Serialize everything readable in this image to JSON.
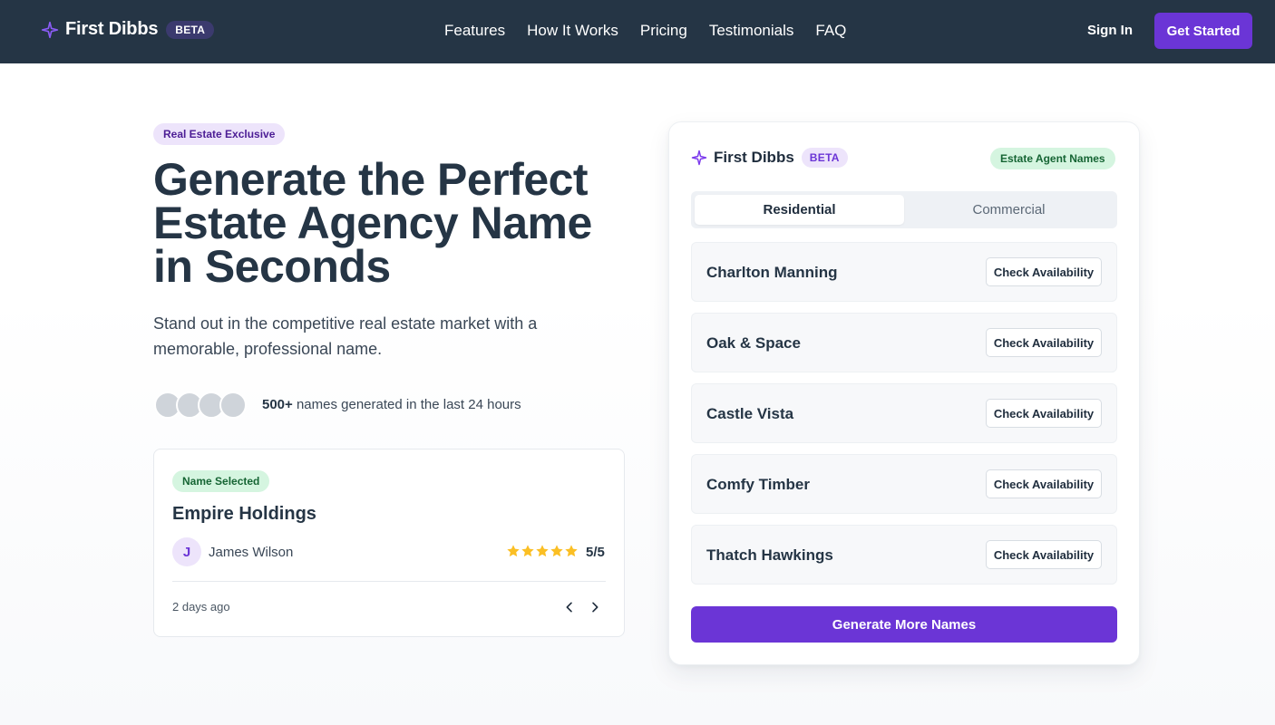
{
  "nav": {
    "brand": "First Dibbs",
    "beta": "BETA",
    "links": [
      "Features",
      "How It Works",
      "Pricing",
      "Testimonials",
      "FAQ"
    ],
    "sign_in": "Sign In",
    "get_started": "Get Started"
  },
  "hero": {
    "tag": "Real Estate Exclusive",
    "title": "Generate the Perfect Estate Agency Name in Seconds",
    "subtitle": "Stand out in the competitive real estate market with a memorable, professional name.",
    "social_count": "500+",
    "social_text": " names generated in the last 24 hours"
  },
  "testimonial": {
    "tag": "Name Selected",
    "name": "Empire Holdings",
    "avatar_initial": "J",
    "person": "James Wilson",
    "stars": 5,
    "rating": "5/5",
    "date": "2 days ago"
  },
  "panel": {
    "brand": "First Dibbs",
    "beta": "BETA",
    "tag": "Estate Agent Names",
    "tabs": [
      "Residential",
      "Commercial"
    ],
    "active_tab": "Residential",
    "names": [
      "Charlton Manning",
      "Oak & Space",
      "Castle Vista",
      "Comfy Timber",
      "Thatch Hawkings"
    ],
    "check_label": "Check Availability",
    "generate_label": "Generate More Names"
  },
  "colors": {
    "navbar": "#253545",
    "accent": "#6b35d6",
    "star": "#fbbf24",
    "green_tag": "#d5f5e0"
  }
}
